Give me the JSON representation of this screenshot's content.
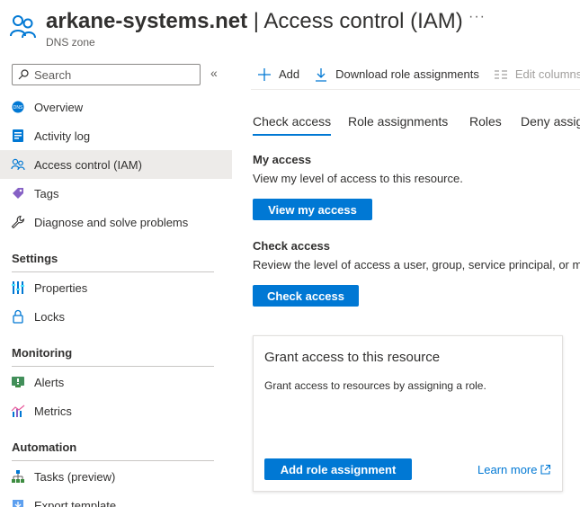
{
  "header": {
    "title_main": "arkane-systems.net",
    "title_rest": " | Access control (IAM)",
    "subtitle": "DNS zone",
    "more": "···"
  },
  "sidebar": {
    "search_placeholder": "Search",
    "collapse": "«",
    "items_top": [
      {
        "label": "Overview",
        "icon": "dns-icon"
      },
      {
        "label": "Activity log",
        "icon": "activity-log-icon"
      },
      {
        "label": "Access control (IAM)",
        "icon": "people-icon",
        "selected": true
      },
      {
        "label": "Tags",
        "icon": "tag-icon"
      },
      {
        "label": "Diagnose and solve problems",
        "icon": "wrench-icon"
      }
    ],
    "sections": [
      {
        "title": "Settings",
        "items": [
          {
            "label": "Properties",
            "icon": "properties-icon"
          },
          {
            "label": "Locks",
            "icon": "lock-icon"
          }
        ]
      },
      {
        "title": "Monitoring",
        "items": [
          {
            "label": "Alerts",
            "icon": "alert-icon"
          },
          {
            "label": "Metrics",
            "icon": "metrics-icon"
          }
        ]
      },
      {
        "title": "Automation",
        "items": [
          {
            "label": "Tasks (preview)",
            "icon": "tasks-icon"
          },
          {
            "label": "Export template",
            "icon": "export-icon"
          }
        ]
      }
    ]
  },
  "toolbar": {
    "add": "Add",
    "download": "Download role assignments",
    "edit_columns": "Edit columns"
  },
  "tabs": [
    "Check access",
    "Role assignments",
    "Roles",
    "Deny assignments"
  ],
  "my_access": {
    "title": "My access",
    "desc": "View my level of access to this resource.",
    "button": "View my access"
  },
  "check_access": {
    "title": "Check access",
    "desc": "Review the level of access a user, group, service principal, or managed identity has to this resource.",
    "button": "Check access"
  },
  "card": {
    "title": "Grant access to this resource",
    "desc": "Grant access to resources by assigning a role.",
    "button": "Add role assignment",
    "link": "Learn more"
  },
  "colors": {
    "accent": "#0078d4",
    "selected_bg": "#edebe9"
  }
}
